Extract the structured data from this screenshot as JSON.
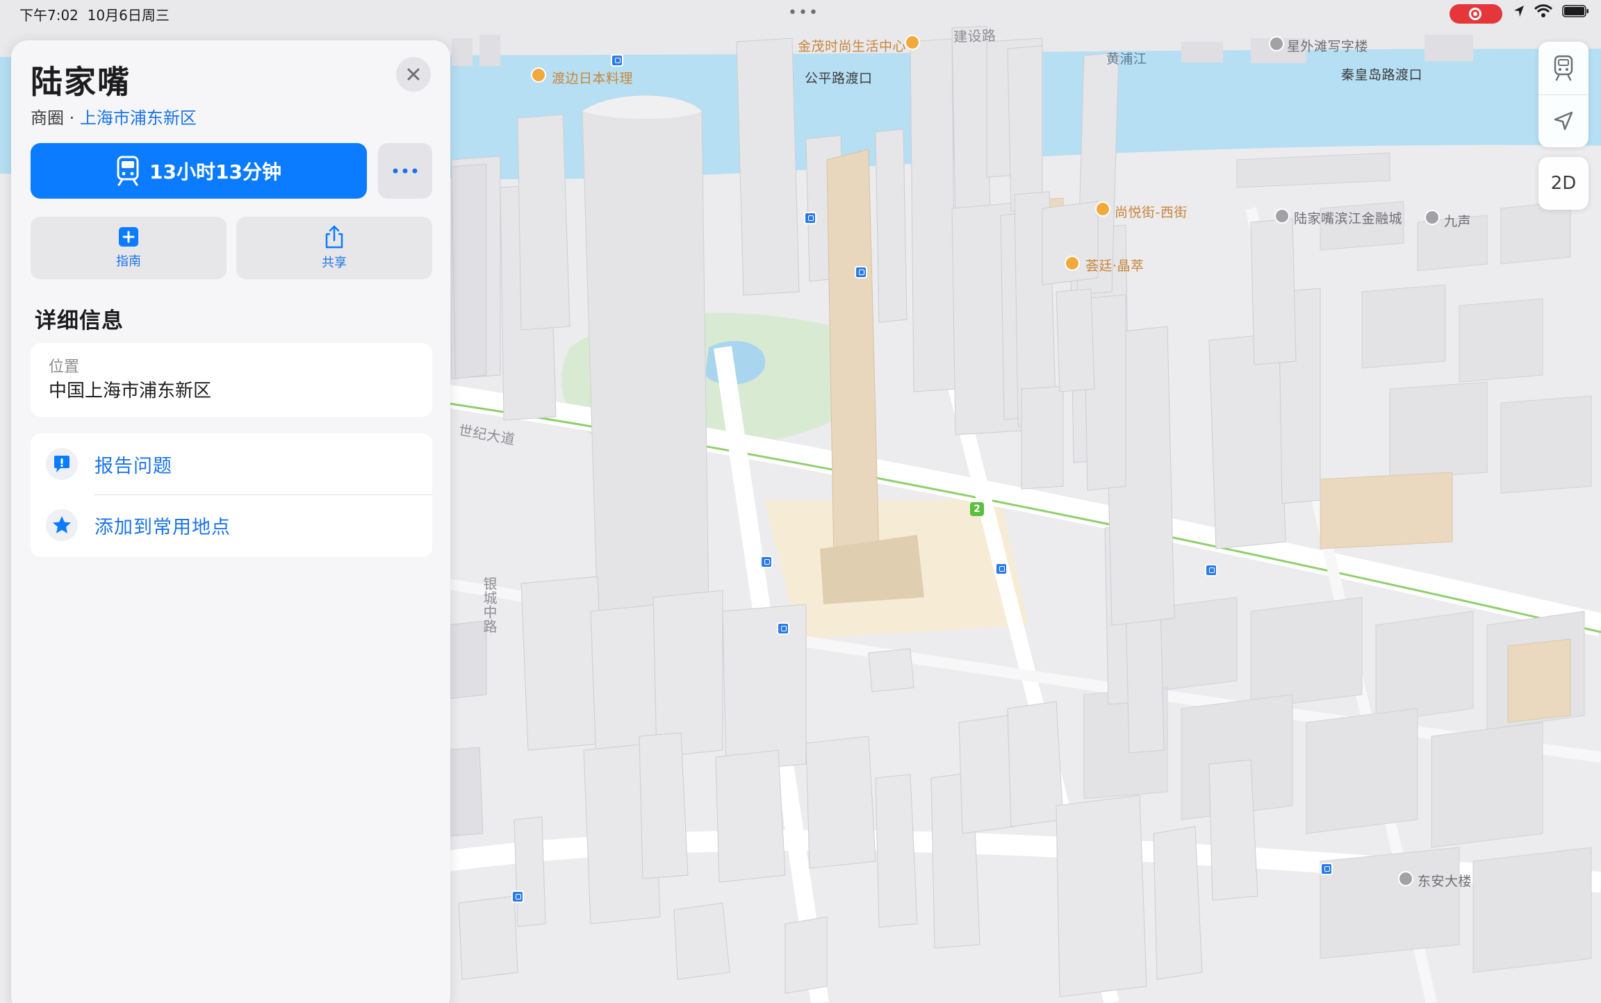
{
  "status_bar": {
    "time": "下午7:02",
    "date": "10月6日周三",
    "multitask_dots": "•••",
    "recording_indicator_color": "#e5373b",
    "icons": [
      "location-arrow-icon",
      "wifi-icon",
      "battery-icon"
    ]
  },
  "panel": {
    "title": "陆家嘴",
    "category": "商圈",
    "separator": " · ",
    "region_link": "上海市浦东新区",
    "close_icon": "close-icon",
    "primary_action": {
      "icon": "train-icon",
      "label": "13小时13分钟",
      "color": "#0b7bff"
    },
    "more_icon": "more-icon",
    "actions": [
      {
        "icon": "plus-square-icon",
        "label": "指南"
      },
      {
        "icon": "share-icon",
        "label": "共享"
      }
    ],
    "details_title": "详细信息",
    "location": {
      "label": "位置",
      "value": "中国上海市浦东新区"
    },
    "rows": [
      {
        "icon": "report-bubble-icon",
        "label": "报告问题"
      },
      {
        "icon": "star-icon",
        "label": "添加到常用地点"
      }
    ]
  },
  "map_controls": {
    "transit_icon": "train-icon",
    "locate_icon": "location-arrow-icon",
    "view_toggle": "2D"
  },
  "map": {
    "labels": {
      "river": "黄浦江",
      "ferry_1": "公平路渡口",
      "ferry_2": "秦皇岛路渡口",
      "poi_1": "金茂时尚生活中心",
      "poi_2": "渡边日本料理",
      "poi_3": "尚悦街-西街",
      "poi_4": "荟廷·晶萃",
      "poi_5": "星外滩写字楼",
      "poi_6": "陆家嘴滨江金融城",
      "poi_7": "九声",
      "poi_8": "东安大楼",
      "road_1": "世纪大道",
      "road_2": "银城中路",
      "road_3": "建设路",
      "metro_line": "2"
    }
  }
}
